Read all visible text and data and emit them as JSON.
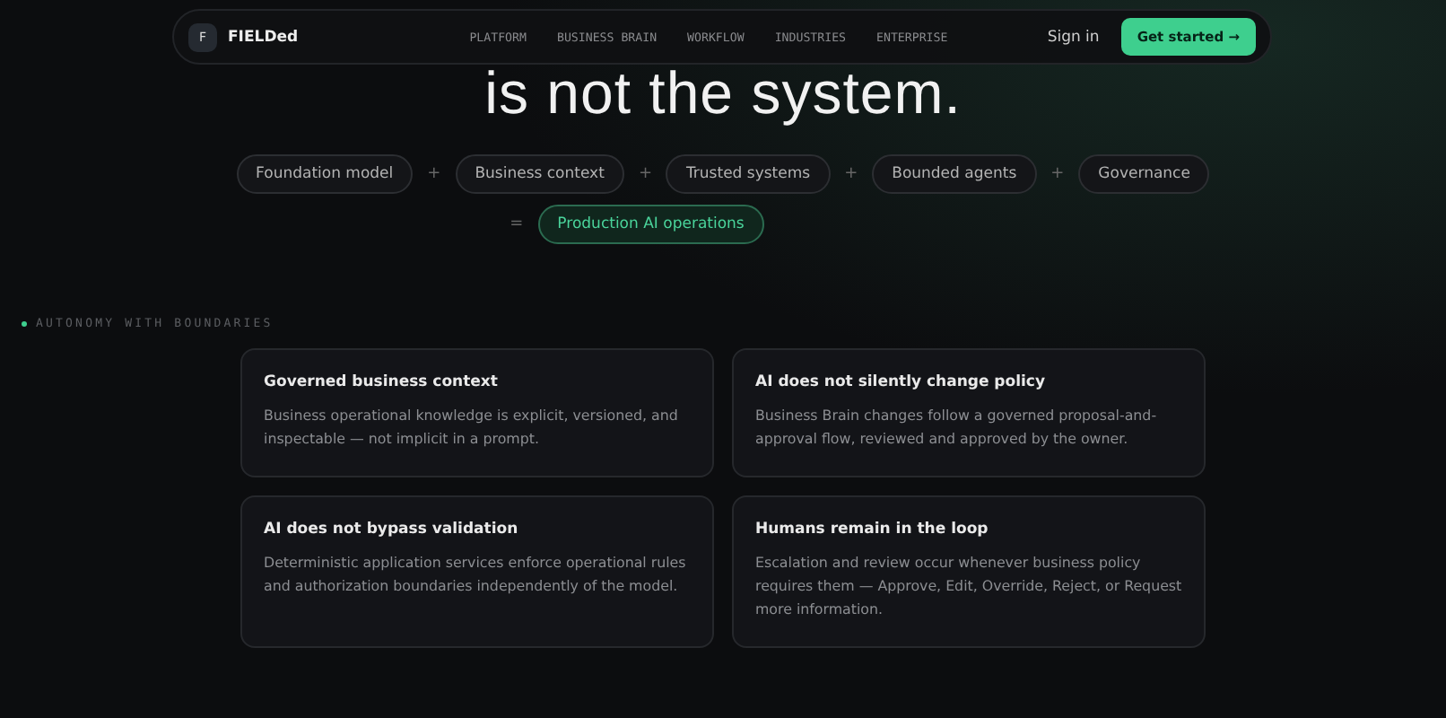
{
  "nav": {
    "logo_mark": "F",
    "brand": "FIELDed",
    "links": [
      "PLATFORM",
      "BUSINESS BRAIN",
      "WORKFLOW",
      "INDUSTRIES",
      "ENTERPRISE"
    ],
    "sign_in": "Sign in",
    "cta": "Get started →"
  },
  "hero": {
    "heading": "is not the system.",
    "terms": [
      "Foundation model",
      "Business context",
      "Trusted systems",
      "Bounded agents",
      "Governance"
    ],
    "plus": "+",
    "equals": "=",
    "result": "Production AI operations"
  },
  "section": {
    "eyebrow": "AUTONOMY WITH BOUNDARIES",
    "color": "#3ecf8e",
    "cards": [
      {
        "title": "Governed business context",
        "body": "Business operational knowledge is explicit, versioned, and inspectable — not implicit in a prompt."
      },
      {
        "title": "AI does not silently change policy",
        "body": "Business Brain changes follow a governed proposal-and-approval flow, reviewed and approved by the owner."
      },
      {
        "title": "AI does not bypass validation",
        "body": "Deterministic application services enforce operational rules and authorization boundaries independently of the model."
      },
      {
        "title": "Humans remain in the loop",
        "body": "Escalation and review occur whenever business policy requires them — Approve, Edit, Override, Reject, or Request more information."
      }
    ]
  }
}
